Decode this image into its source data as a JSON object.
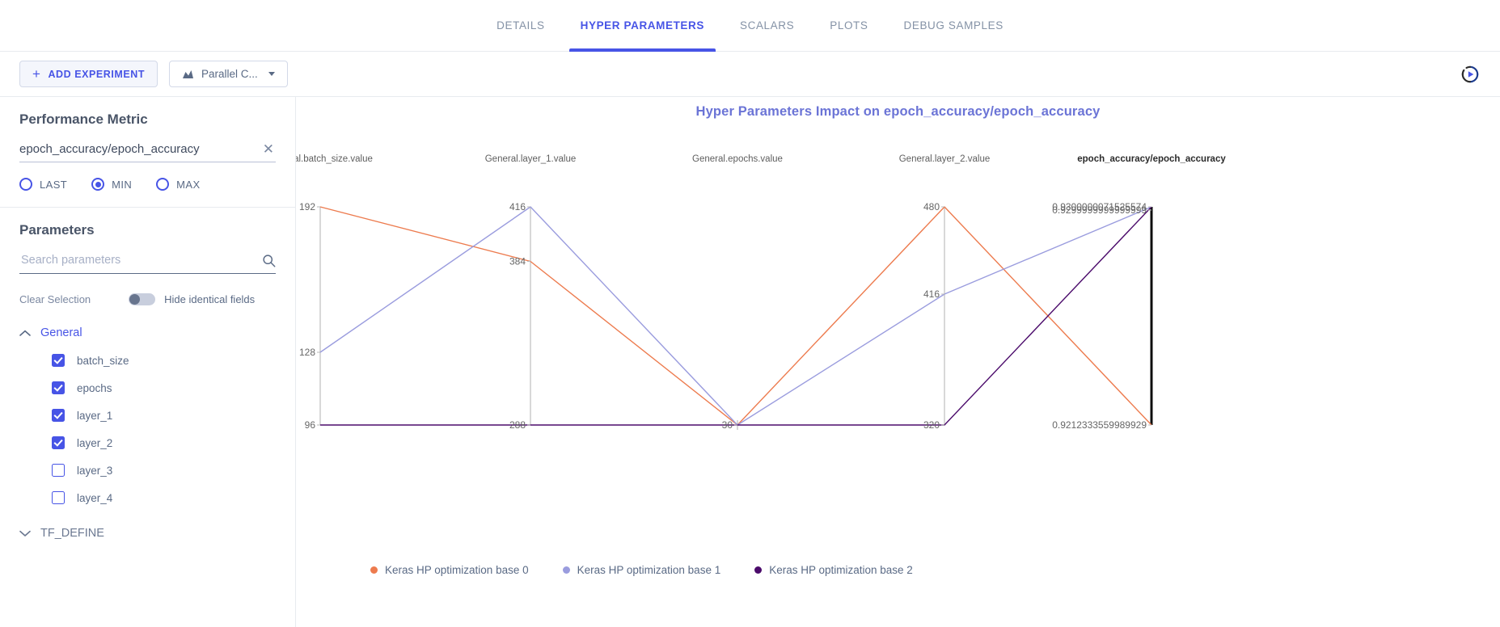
{
  "tabs": [
    {
      "label": "DETAILS",
      "active": false
    },
    {
      "label": "HYPER PARAMETERS",
      "active": true
    },
    {
      "label": "SCALARS",
      "active": false
    },
    {
      "label": "PLOTS",
      "active": false
    },
    {
      "label": "DEBUG SAMPLES",
      "active": false
    }
  ],
  "toolbar": {
    "add_experiment_label": "ADD EXPERIMENT",
    "plus_glyph": "+",
    "chart_type_label": "Parallel C...",
    "refresh_icon": "auto-refresh-icon"
  },
  "sidebar": {
    "performance_metric": {
      "title": "Performance Metric",
      "value": "epoch_accuracy/epoch_accuracy",
      "clear_glyph": "✕",
      "modes": [
        {
          "label": "LAST",
          "selected": false
        },
        {
          "label": "MIN",
          "selected": true
        },
        {
          "label": "MAX",
          "selected": false
        }
      ]
    },
    "parameters": {
      "title": "Parameters",
      "search_placeholder": "Search parameters",
      "search_value": "",
      "clear_selection_label": "Clear Selection",
      "hide_identical_label": "Hide identical fields",
      "hide_identical_on": false,
      "groups": [
        {
          "name": "General",
          "expanded": true,
          "items": [
            {
              "label": "batch_size",
              "checked": true
            },
            {
              "label": "epochs",
              "checked": true
            },
            {
              "label": "layer_1",
              "checked": true
            },
            {
              "label": "layer_2",
              "checked": true
            },
            {
              "label": "layer_3",
              "checked": false
            },
            {
              "label": "layer_4",
              "checked": false
            }
          ]
        },
        {
          "name": "TF_DEFINE",
          "expanded": false,
          "items": []
        }
      ]
    }
  },
  "chart_data": {
    "type": "line",
    "subtype": "parallel-coordinates",
    "title": "Hyper Parameters Impact on epoch_accuracy/epoch_accuracy",
    "xlabel": "",
    "ylabel": "",
    "grid": false,
    "legend_position": "bottom-left",
    "axes": [
      {
        "name": "General.batch_size.value",
        "ticks": [
          "192",
          "128",
          "96"
        ],
        "tick_values": [
          192,
          128,
          96
        ],
        "domain": [
          96,
          192
        ],
        "is_metric": false
      },
      {
        "name": "General.layer_1.value",
        "ticks": [
          "416",
          "384",
          "288"
        ],
        "tick_values": [
          416,
          384,
          288
        ],
        "domain": [
          288,
          416
        ],
        "is_metric": false
      },
      {
        "name": "General.epochs.value",
        "ticks": [
          "30"
        ],
        "tick_values": [
          30
        ],
        "domain": [
          30,
          30
        ],
        "is_metric": false
      },
      {
        "name": "General.layer_2.value",
        "ticks": [
          "480",
          "416",
          "320"
        ],
        "tick_values": [
          480,
          416,
          320
        ],
        "domain": [
          320,
          480
        ],
        "is_metric": false
      },
      {
        "name": "epoch_accuracy/epoch_accuracy",
        "ticks": [
          "0.9300000071525574",
          "0.9299999999999999",
          "0.9212333559989929"
        ],
        "tick_values": [
          0.9300000071525574,
          0.93,
          0.9212333559989929
        ],
        "domain": [
          0.9212333559989929,
          0.9300000071525574
        ],
        "is_metric": true
      }
    ],
    "series": [
      {
        "name": "Keras HP optimization base 0",
        "color": "#ED7B4E",
        "values": [
          192,
          384,
          30,
          480,
          0.9212333559989929
        ]
      },
      {
        "name": "Keras HP optimization base 1",
        "color": "#9A9CDE",
        "values": [
          128,
          416,
          30,
          416,
          0.9300000071525574
        ]
      },
      {
        "name": "Keras HP optimization base 2",
        "color": "#4B0B6B",
        "values": [
          96,
          288,
          30,
          320,
          0.9300000071525574
        ]
      }
    ]
  },
  "colors": {
    "accent": "#4754e6",
    "title": "#6b74d6",
    "text": "#5a6a85",
    "border": "#e8ebef"
  }
}
